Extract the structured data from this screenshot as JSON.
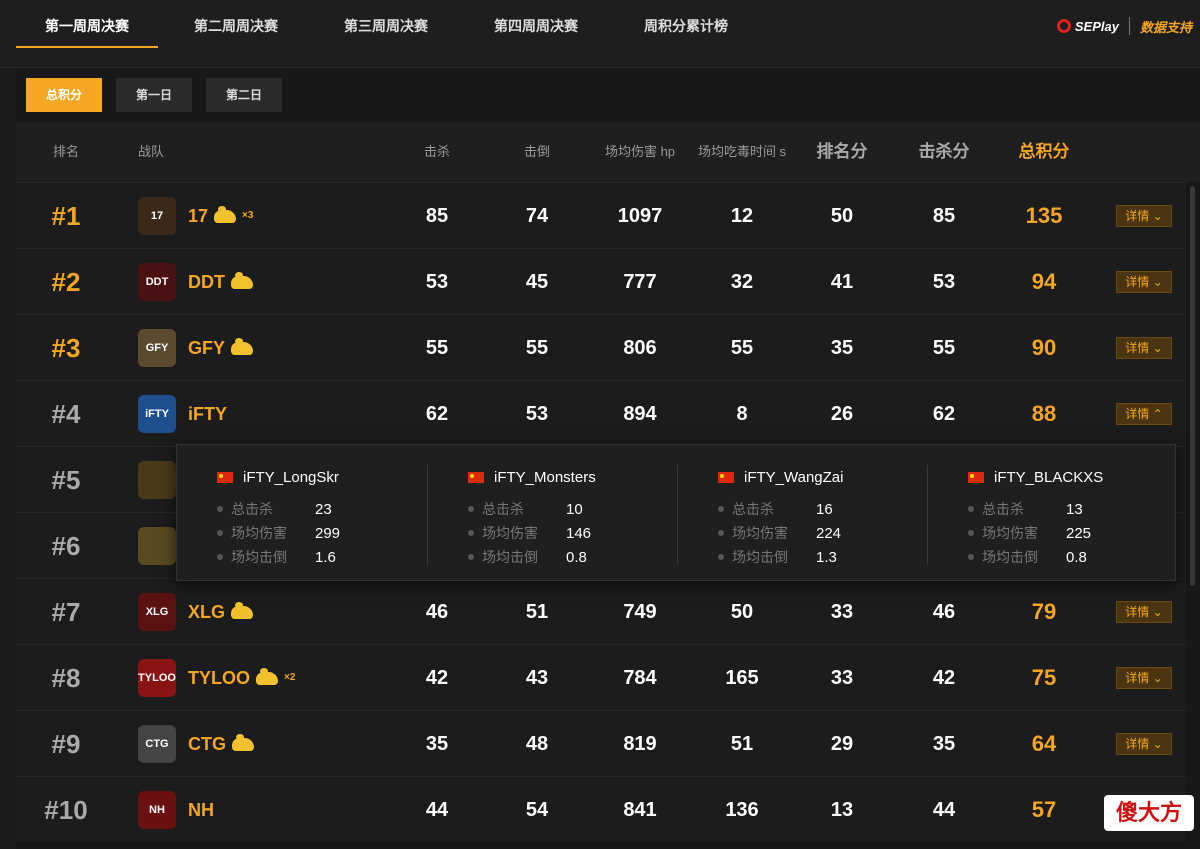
{
  "nav": {
    "tabs": [
      "第一周周决赛",
      "第二周周决赛",
      "第三周周决赛",
      "第四周周决赛",
      "周积分累计榜"
    ],
    "brand_left": "SEPlay",
    "brand_right": "数据支持"
  },
  "day_tabs": [
    "总积分",
    "第一日",
    "第二日"
  ],
  "columns": [
    "排名",
    "战队",
    "击杀",
    "击倒",
    "场均伤害 hp",
    "场均吃毒时间 s",
    "排名分",
    "击杀分",
    "总积分"
  ],
  "detail_label": "详情",
  "rows": [
    {
      "rank": "#1",
      "team": "17",
      "chicken": true,
      "mult": "×3",
      "kills": "85",
      "knocks": "74",
      "dmg": "1097",
      "poison": "12",
      "place_pts": "50",
      "kill_pts": "85",
      "total": "135",
      "logo_color": "#3b2a1a",
      "logo_text": "17",
      "open": false
    },
    {
      "rank": "#2",
      "team": "DDT",
      "chicken": true,
      "mult": "",
      "kills": "53",
      "knocks": "45",
      "dmg": "777",
      "poison": "32",
      "place_pts": "41",
      "kill_pts": "53",
      "total": "94",
      "logo_color": "#4a1212",
      "logo_text": "DDT",
      "open": false
    },
    {
      "rank": "#3",
      "team": "GFY",
      "chicken": true,
      "mult": "",
      "kills": "55",
      "knocks": "55",
      "dmg": "806",
      "poison": "55",
      "place_pts": "35",
      "kill_pts": "55",
      "total": "90",
      "logo_color": "#5a4a30",
      "logo_text": "GFY",
      "open": false
    },
    {
      "rank": "#4",
      "team": "iFTY",
      "chicken": false,
      "mult": "",
      "kills": "62",
      "knocks": "53",
      "dmg": "894",
      "poison": "8",
      "place_pts": "26",
      "kill_pts": "62",
      "total": "88",
      "logo_color": "#1f4f8f",
      "logo_text": "iFTY",
      "open": true
    },
    {
      "rank": "#5",
      "team": "",
      "chicken": false,
      "mult": "",
      "kills": "",
      "knocks": "",
      "dmg": "",
      "poison": "",
      "place_pts": "",
      "kill_pts": "",
      "total": "",
      "logo_color": "#4a3a1a",
      "logo_text": "",
      "open": false
    },
    {
      "rank": "#6",
      "team": "",
      "chicken": false,
      "mult": "",
      "kills": "",
      "knocks": "",
      "dmg": "",
      "poison": "",
      "place_pts": "",
      "kill_pts": "",
      "total": "",
      "logo_color": "#5a4a20",
      "logo_text": "",
      "open": false
    },
    {
      "rank": "#7",
      "team": "XLG",
      "chicken": true,
      "mult": "",
      "kills": "46",
      "knocks": "51",
      "dmg": "749",
      "poison": "50",
      "place_pts": "33",
      "kill_pts": "46",
      "total": "79",
      "logo_color": "#5a1212",
      "logo_text": "XLG",
      "open": false
    },
    {
      "rank": "#8",
      "team": "TYLOO",
      "chicken": true,
      "mult": "×2",
      "kills": "42",
      "knocks": "43",
      "dmg": "784",
      "poison": "165",
      "place_pts": "33",
      "kill_pts": "42",
      "total": "75",
      "logo_color": "#8a1414",
      "logo_text": "TYLOO",
      "open": false
    },
    {
      "rank": "#9",
      "team": "CTG",
      "chicken": true,
      "mult": "",
      "kills": "35",
      "knocks": "48",
      "dmg": "819",
      "poison": "51",
      "place_pts": "29",
      "kill_pts": "35",
      "total": "64",
      "logo_color": "#444444",
      "logo_text": "CTG",
      "open": false
    },
    {
      "rank": "#10",
      "team": "NH",
      "chicken": false,
      "mult": "",
      "kills": "44",
      "knocks": "54",
      "dmg": "841",
      "poison": "136",
      "place_pts": "13",
      "kill_pts": "44",
      "total": "57",
      "logo_color": "#6a1010",
      "logo_text": "NH",
      "open": false
    }
  ],
  "popup": {
    "stat_labels": [
      "总击杀",
      "场均伤害",
      "场均击倒"
    ],
    "players": [
      {
        "name": "iFTY_LongSkr",
        "stats": [
          "23",
          "299",
          "1.6"
        ]
      },
      {
        "name": "iFTY_Monsters",
        "stats": [
          "10",
          "146",
          "0.8"
        ]
      },
      {
        "name": "iFTY_WangZai",
        "stats": [
          "16",
          "224",
          "1.3"
        ]
      },
      {
        "name": "iFTY_BLACKXS",
        "stats": [
          "13",
          "225",
          "0.8"
        ]
      }
    ]
  },
  "sticker": "傻大方",
  "colors": {
    "accent": "#f5a623",
    "bg": "#1a1a1a"
  }
}
